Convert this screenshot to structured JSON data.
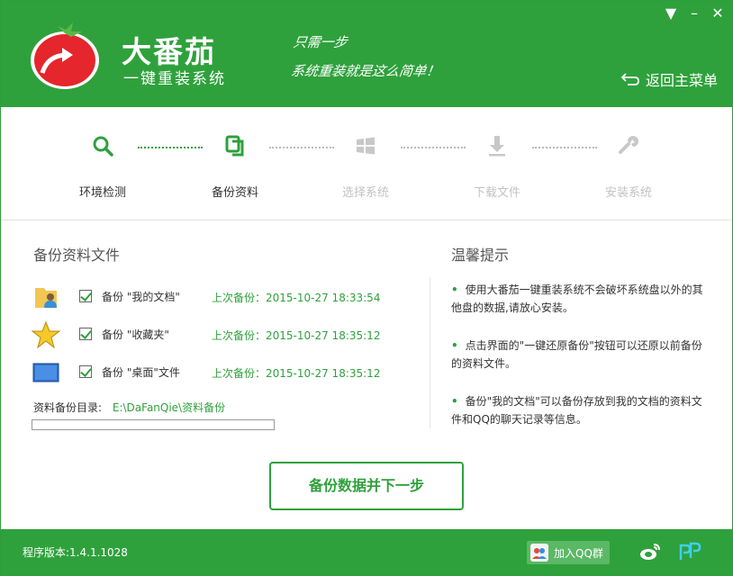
{
  "window": {
    "controls": {
      "menu": "▼",
      "minimize": "–",
      "close": "✕"
    }
  },
  "header": {
    "brand_name": "大番茄",
    "brand_sub": "一键重装系统",
    "slogan_line1": "只需一步",
    "slogan_line2": "系统重装就是这么简单！",
    "back_home": "返回主菜单",
    "back_icon": "return-arrow-icon"
  },
  "steps": [
    {
      "label": "环境检测",
      "icon": "search-icon",
      "state": "done"
    },
    {
      "label": "备份资料",
      "icon": "copy-icon",
      "state": "active"
    },
    {
      "label": "选择系统",
      "icon": "windows-icon",
      "state": "pending"
    },
    {
      "label": "下载文件",
      "icon": "download-icon",
      "state": "pending"
    },
    {
      "label": "安装系统",
      "icon": "wrench-icon",
      "state": "pending"
    }
  ],
  "backup": {
    "title": "备份资料文件",
    "items": [
      {
        "label": "备份 \"我的文档\"",
        "last": "上次备份：2015-10-27 18:33:54",
        "icon": "documents-folder-icon",
        "checked": true
      },
      {
        "label": "备份 \"收藏夹\"",
        "last": "上次备份：2015-10-27 18:35:12",
        "icon": "favorites-star-icon",
        "checked": true
      },
      {
        "label": "备份 \"桌面\"文件",
        "last": "上次备份：2015-10-27 18:35:12",
        "icon": "desktop-icon",
        "checked": true
      }
    ],
    "dir_label": "资料备份目录:",
    "dir_path": "E:\\DaFanQie\\资料备份",
    "progress": 0
  },
  "tips": {
    "title": "温馨提示",
    "items": [
      "使用大番茄一键重装系统不会破坏系统盘以外的其他盘的数据,请放心安装。",
      "点击界面的\"一键还原备份\"按钮可以还原以前备份的资料文件。",
      "备份\"我的文档\"可以备份存放到我的文档的资料文件和QQ的聊天记录等信息。"
    ]
  },
  "primary_button": "备份数据并下一步",
  "footer": {
    "version": "程序版本:1.4.1.1028",
    "qq_group": "加入QQ群"
  },
  "colors": {
    "brand_green": "#2fa13c",
    "inactive_gray": "#c2c2c2"
  }
}
